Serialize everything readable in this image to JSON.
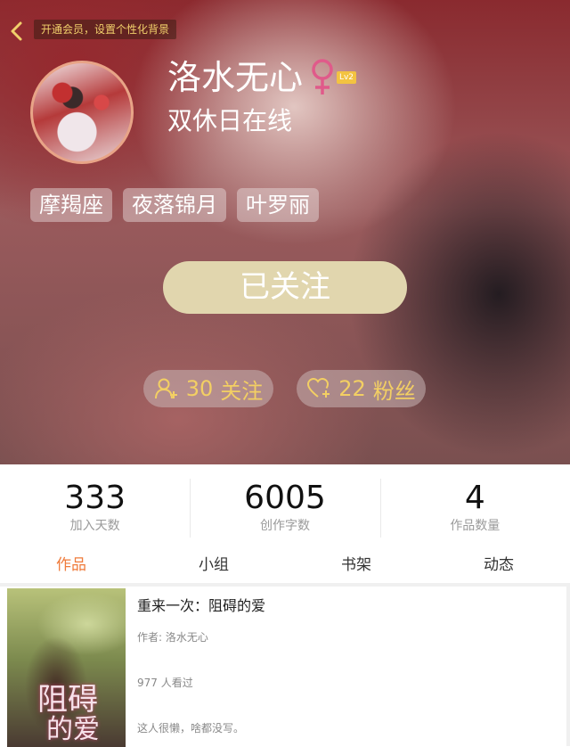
{
  "header": {
    "member_banner": "开通会员，设置个性化背景",
    "username": "洛水无心",
    "level": "Lv2",
    "status": "双休日在线",
    "tags": [
      "摩羯座",
      "夜落锦月",
      "叶罗丽"
    ],
    "follow_button": "已关注",
    "following_count": "30",
    "following_label": "关注",
    "fans_count": "22",
    "fans_label": "粉丝"
  },
  "stats": [
    {
      "value": "333",
      "label": "加入天数"
    },
    {
      "value": "6005",
      "label": "创作字数"
    },
    {
      "value": "4",
      "label": "作品数量"
    }
  ],
  "tabs": [
    "作品",
    "小组",
    "书架",
    "动态"
  ],
  "active_tab": "作品",
  "works": [
    {
      "title": "重来一次：阻碍的爱",
      "author": "作者: 洛水无心",
      "views": "977 人看过",
      "description": "这人很懒，啥都没写。",
      "cover_text_1": "阻碍",
      "cover_text_2": "的爱"
    }
  ],
  "colors": {
    "accent_orange": "#ef7a3a",
    "gold": "#f3cf63",
    "follow_button": "#e1d6ae",
    "gender_female": "#e05a8a"
  }
}
